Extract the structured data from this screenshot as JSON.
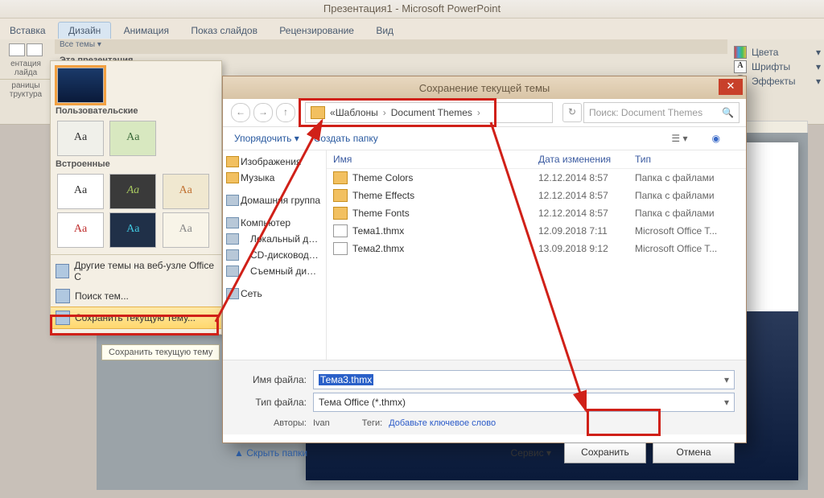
{
  "app": {
    "title": "Презентация1 - Microsoft PowerPoint"
  },
  "tabs": [
    "Вставка",
    "Дизайн",
    "Анимация",
    "Показ слайдов",
    "Рецензирование",
    "Вид"
  ],
  "ribbon": {
    "left1": "ентация",
    "left2": "лайда",
    "left3": "раницы",
    "left4": "труктура",
    "themes_header": "Все темы ▾",
    "subheader": "Эта презентация",
    "right": {
      "colors": "Цвета",
      "fonts": "Шрифты",
      "effects": "Эффекты"
    }
  },
  "gallery": {
    "h2": "Пользовательские",
    "h3": "Встроенные",
    "m1": "Другие темы на веб-узле Office C",
    "m2": "Поиск тем...",
    "m3": "Сохранить текущую тему...",
    "tooltip": "Сохранить текущую тему"
  },
  "dialog": {
    "title": "Сохранение текущей темы",
    "crumb1": "Шаблоны",
    "crumb2": "Document Themes",
    "search_ph": "Поиск: Document Themes",
    "tb1": "Упорядочить ▾",
    "tb2": "Создать папку",
    "tree": [
      "Изображения",
      "Музыка",
      "",
      "Домашняя группа",
      "",
      "Компьютер",
      "Локальный диск",
      "CD-дисковод (D:",
      "Съемный диск (",
      "",
      "Сеть"
    ],
    "cols": {
      "c1": "Имя",
      "c2": "Дата изменения",
      "c3": "Тип"
    },
    "rows": [
      {
        "ic": "folder",
        "n": "Theme Colors",
        "d": "12.12.2014 8:57",
        "t": "Папка с файлами"
      },
      {
        "ic": "folder",
        "n": "Theme Effects",
        "d": "12.12.2014 8:57",
        "t": "Папка с файлами"
      },
      {
        "ic": "folder",
        "n": "Theme Fonts",
        "d": "12.12.2014 8:57",
        "t": "Папка с файлами"
      },
      {
        "ic": "file",
        "n": "Тема1.thmx",
        "d": "12.09.2018 7:11",
        "t": "Microsoft Office T..."
      },
      {
        "ic": "file",
        "n": "Тема2.thmx",
        "d": "13.09.2018 9:12",
        "t": "Microsoft Office T..."
      }
    ],
    "fname_label": "Имя файла:",
    "fname_value": "Тема3.thmx",
    "ftype_label": "Тип файла:",
    "ftype_value": "Тема Office (*.thmx)",
    "authors_label": "Авторы:",
    "authors_value": "Ivan",
    "tags_label": "Теги:",
    "tags_value": "Добавьте ключевое слово",
    "hide": "Скрыть папки",
    "tools": "Сервис  ▾",
    "save": "Сохранить",
    "cancel": "Отмена"
  }
}
